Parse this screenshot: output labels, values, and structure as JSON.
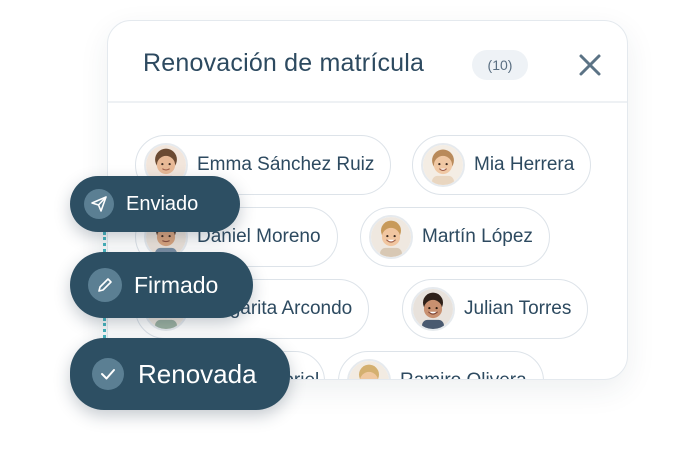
{
  "panel": {
    "title": "Renovación de matrícula",
    "count": "(10)",
    "close_icon": "close-icon"
  },
  "students": [
    {
      "name": "Emma Sánchez Ruiz",
      "avatar_color": "#c89a7a"
    },
    {
      "name": "Mia Herrera",
      "avatar_color": "#e0b48c"
    },
    {
      "name": "Daniel Moreno",
      "avatar_color": "#b88a6a"
    },
    {
      "name": "Martín López",
      "avatar_color": "#d8b08a"
    },
    {
      "name": "Margarita Arcondo",
      "avatar_color": "#c49a7c"
    },
    {
      "name": "Julian Torres",
      "avatar_color": "#9a6a4e"
    },
    {
      "name": "Gabriel",
      "avatar_color": "#c9a07e"
    },
    {
      "name": "Ramiro Olivera",
      "avatar_color": "#d9b98a"
    }
  ],
  "statuses": [
    {
      "label": "Enviado",
      "icon": "send-icon"
    },
    {
      "label": "Firmado",
      "icon": "pen-icon"
    },
    {
      "label": "Renovada",
      "icon": "check-icon"
    }
  ],
  "colors": {
    "pill_bg": "#2d4f63",
    "icon_circle": "#5b7f93",
    "connector": "#47b3bd",
    "text": "#2d4a60"
  }
}
